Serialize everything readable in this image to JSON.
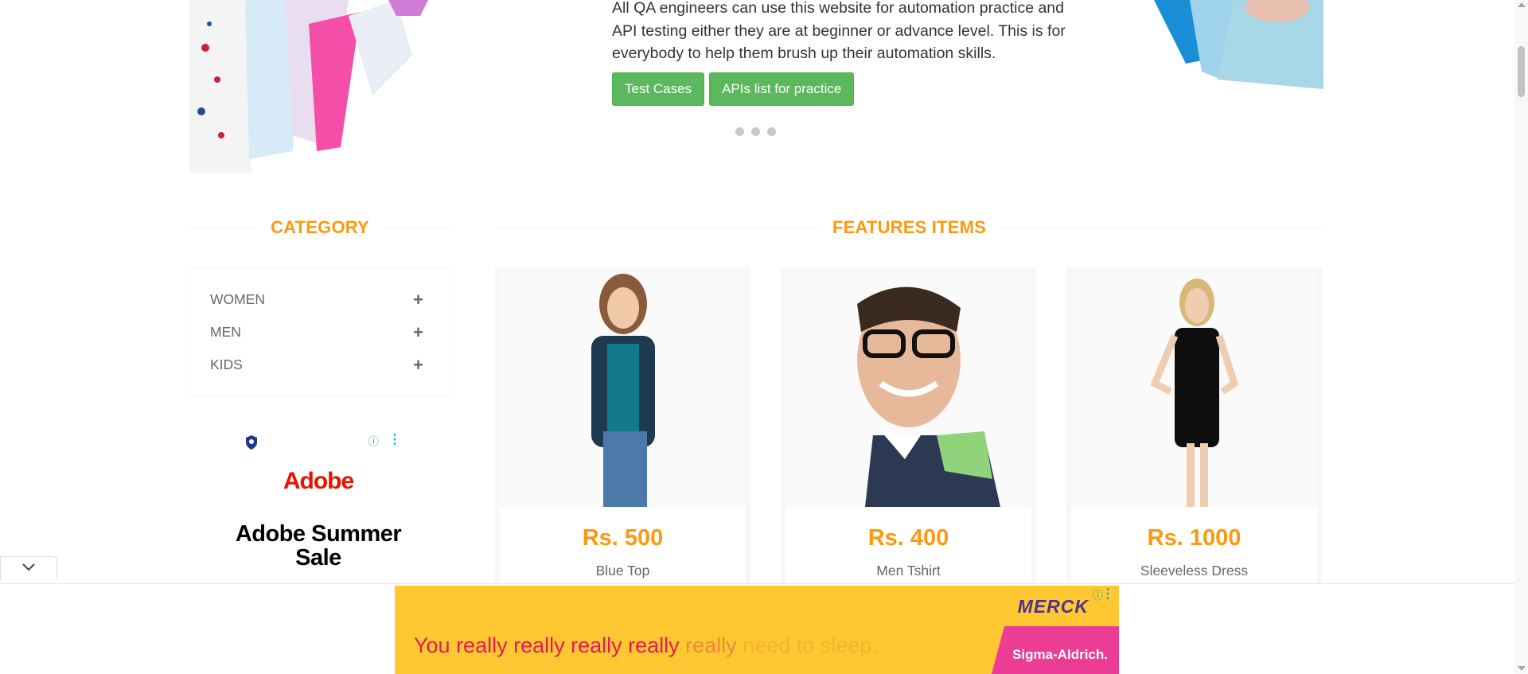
{
  "hero": {
    "text": "All QA engineers can use this website for automation practice and API testing either they are at beginner or advance level. This is for everybody to help them brush up their automation skills.",
    "buttons": [
      {
        "label": "Test Cases"
      },
      {
        "label": "APIs list for practice"
      }
    ],
    "slide_count": 3
  },
  "category": {
    "title": "CATEGORY",
    "items": [
      {
        "label": "WOMEN"
      },
      {
        "label": "MEN"
      },
      {
        "label": "KIDS"
      }
    ]
  },
  "features": {
    "title": "FEATURES ITEMS",
    "products": [
      {
        "price": "Rs. 500",
        "name": "Blue Top"
      },
      {
        "price": "Rs. 400",
        "name": "Men Tshirt"
      },
      {
        "price": "Rs. 1000",
        "name": "Sleeveless Dress"
      }
    ]
  },
  "ads": {
    "left": {
      "brand": "Adobe",
      "headline": "Adobe Summer Sale",
      "icons": [
        "shield-icon",
        "info-icon",
        "kebab-icon"
      ]
    },
    "bottom": {
      "brand": "MERCK",
      "tagline_parts": [
        "You really really really really ",
        "really ",
        "need to sleep."
      ],
      "badge": "Sigma-Aldrich."
    }
  },
  "colors": {
    "accent_orange": "#fe980f",
    "button_green": "#5cb85c",
    "ad_yellow": "#ffc832",
    "merck_purple": "#503291",
    "sigma_pink": "#eb3c96"
  }
}
